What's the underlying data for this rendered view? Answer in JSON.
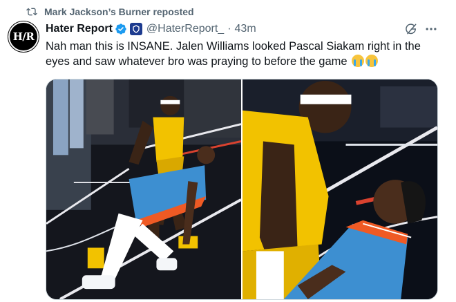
{
  "repost": {
    "text": "Mark Jackson’s Burner reposted",
    "icon": "repost-icon"
  },
  "author": {
    "avatar_text": "H/R",
    "display_name": "Hater Report",
    "handle": "@HaterReport_",
    "separator": "·",
    "time": "43m",
    "verified_icon": "verified-badge-icon",
    "affiliate_icon": "affiliate-badge-icon"
  },
  "tweet": {
    "text": "Nah man this is INSANE. Jalen Williams looked Pascal Siakam right in the eyes and saw whatever bro was praying to before the game",
    "emojis": [
      "loudly-crying-face",
      "loudly-crying-face"
    ]
  },
  "actions": {
    "grok_icon": "grok-icon",
    "more_icon": "more-icon"
  },
  "media": {
    "count": 2,
    "colors": {
      "pacers_yellow": "#f2c200",
      "thunder_blue": "#3d8fd1",
      "thunder_orange": "#ef5a24",
      "court_dark": "#14161d"
    }
  },
  "colors": {
    "text_primary": "#0f1419",
    "text_secondary": "#536471",
    "verified_blue": "#1d9bf0",
    "border": "#cfd9de"
  }
}
